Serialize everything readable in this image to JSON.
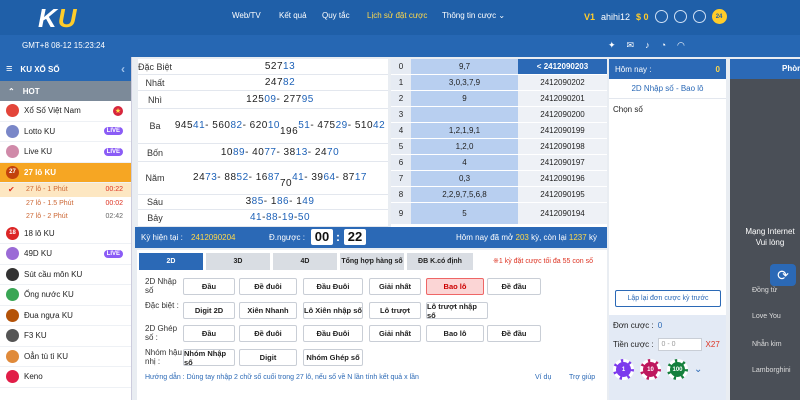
{
  "header": {
    "logo_k": "K",
    "logo_u": "U",
    "nav": [
      "Web/TV",
      "Kết quả",
      "Quy tắc",
      "Lịch sử đặt cược",
      "Thông tin cược ⌄"
    ],
    "vip": "V1",
    "username": "ahihi12",
    "balance": "$ 0",
    "badge": "24"
  },
  "subbar": {
    "time": "GMT+8 08-12 15:23:24"
  },
  "sidebar": {
    "title": "KU XỔ SỐ",
    "hot": "HOT",
    "items": [
      {
        "label": "Xổ Số Việt Nam",
        "tag": "flag"
      },
      {
        "label": "Lotto KU",
        "tag": "LIVE"
      },
      {
        "label": "Live KU",
        "tag": "LIVE"
      },
      {
        "label": "27 lô KU",
        "tag": "27"
      },
      {
        "label": "18 lô KU",
        "tag": "18"
      },
      {
        "label": "49D KU",
        "tag": "LIVE"
      },
      {
        "label": "Sút cầu môn KU",
        "tag": ""
      },
      {
        "label": "Ống nước KU",
        "tag": ""
      },
      {
        "label": "Đua ngựa KU",
        "tag": ""
      },
      {
        "label": "F3 KU",
        "tag": ""
      },
      {
        "label": "Oẳn tù tì KU",
        "tag": ""
      },
      {
        "label": "Keno",
        "tag": ""
      }
    ],
    "subs": [
      {
        "label": "27 lô - 1 Phút",
        "time": "00:22"
      },
      {
        "label": "27 lô - 1.5 Phút",
        "time": "00:02"
      },
      {
        "label": "27 lô - 2 Phút",
        "time": "02:42"
      }
    ]
  },
  "results": [
    {
      "label": "Đặc Biệt",
      "pre": [
        "527"
      ],
      "hi": [
        "13"
      ]
    },
    {
      "label": "Nhất",
      "pre": [
        "247"
      ],
      "hi": [
        "82"
      ]
    },
    {
      "label": "Nhì",
      "pre": [
        "125",
        "277"
      ],
      "hi": [
        "09",
        "95"
      ]
    },
    {
      "label": "Ba",
      "pre": [
        "945",
        "560",
        "620",
        "196",
        "475",
        "510"
      ],
      "hi": [
        "41",
        "82",
        "10",
        "51",
        "29",
        "42"
      ]
    },
    {
      "label": "Bốn",
      "pre": [
        "10",
        "40",
        "38",
        "24"
      ],
      "hi": [
        "89",
        "77",
        "13",
        "70"
      ]
    },
    {
      "label": "Năm",
      "pre": [
        "24",
        "88",
        "16",
        "70",
        "39",
        "87"
      ],
      "hi": [
        "73",
        "52",
        "87",
        "41",
        "64",
        "17"
      ]
    },
    {
      "label": "Sáu",
      "pre": [
        "3",
        "1",
        "1"
      ],
      "hi": [
        "85",
        "86",
        "49"
      ]
    },
    {
      "label": "Bảy",
      "pre": [
        "",
        "",
        "",
        ""
      ],
      "hi": [
        "41",
        "88",
        "19",
        "50"
      ]
    }
  ],
  "stats": [
    {
      "i": "0",
      "v": "9,7",
      "id": "< 2412090203"
    },
    {
      "i": "1",
      "v": "3,0,3,7,9",
      "id": "2412090202"
    },
    {
      "i": "2",
      "v": "9",
      "id": "2412090201"
    },
    {
      "i": "3",
      "v": "",
      "id": "2412090200"
    },
    {
      "i": "4",
      "v": "1,2,1,9,1",
      "id": "2412090199"
    },
    {
      "i": "5",
      "v": "1,2,0",
      "id": "2412090198"
    },
    {
      "i": "6",
      "v": "4",
      "id": "2412090197"
    },
    {
      "i": "7",
      "v": "0,3",
      "id": "2412090196"
    },
    {
      "i": "8",
      "v": "2,2,9,7,5,6,8",
      "id": "2412090195"
    },
    {
      "i": "9",
      "v": "5",
      "id": "2412090194"
    }
  ],
  "kybar": {
    "ky_label": "Kỳ hiện tại :",
    "ky_value": "2412090204",
    "countdown_label": "Đ.ngược :",
    "mm": "00",
    "ss": "22",
    "today_a": "Hôm nay đã mở",
    "today_b": "203",
    "today_c": "kỳ, còn lại",
    "today_d": "1237",
    "today_e": "kỳ"
  },
  "tabs": [
    "2D",
    "3D",
    "4D",
    "Tổng hợp hàng số",
    "ĐB K.có định"
  ],
  "tab_note": "※1 kỳ đặt cược tối đa 55 con số",
  "groups": [
    {
      "label": "2D Nhập số",
      "buttons": [
        "Đầu",
        "Đề đuôi",
        "Đầu Đuôi",
        "Giải nhất",
        "Bao lô",
        "Đề đầu"
      ]
    },
    {
      "label": "Đặc biệt :",
      "buttons": [
        "Digit 2D",
        "Xiên Nhanh",
        "Lô Xiên nhập số",
        "Lô trượt",
        "Lô trượt nhập số"
      ]
    },
    {
      "label": "2D Ghép số :",
      "buttons": [
        "Đầu",
        "Đề đuôi",
        "Đầu Đuôi",
        "Giải nhất",
        "Bao lô",
        "Đề đầu"
      ]
    },
    {
      "label": "Nhóm hậu nhị :",
      "buttons": [
        "Nhóm Nhập số",
        "Digit",
        "Nhóm Ghép số"
      ]
    }
  ],
  "guide": "Hướng dẫn : Dùng tay nhập 2 chữ số cuối trong 27 lô, nếu số về N lần tính kết quả x lần",
  "guide_links": [
    "Ví dụ",
    "Trợ giúp"
  ],
  "right": {
    "today": "Hôm nay :",
    "count": "0",
    "title": "2D Nhập số - Bao lô",
    "chon": "Chọn số",
    "list_btn": "Lập lại đơn cược kỳ trước",
    "don_label": "Đơn cược :",
    "don_val": "0",
    "tien_label": "Tiền cược :",
    "tien_ph": "0 - 0",
    "mult": "X27",
    "chips": [
      "1",
      "10",
      "100"
    ]
  },
  "far": {
    "head": "Phòr",
    "net1": "Mạng Internet",
    "net2": "Vui lòng",
    "rows": [
      "Đồng từ",
      "Love You",
      "Nhẫn kim",
      "Lamborghini"
    ]
  },
  "colors": {
    "primary": "#2b69b6",
    "accent": "#f6a623",
    "highlight": "#ffd94a"
  }
}
